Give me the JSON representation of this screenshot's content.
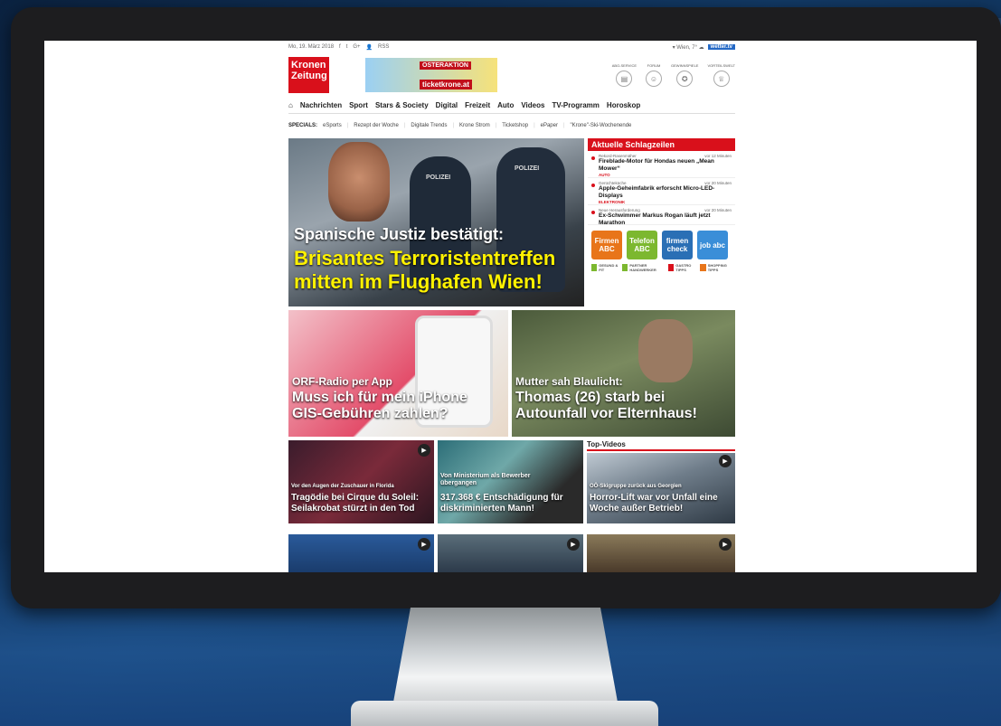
{
  "topbar": {
    "date": "Mo, 19. März 2018",
    "social": [
      "f",
      "t",
      "G+",
      "👤",
      "RSS"
    ],
    "weather": "▾ Wien, 7° ☁",
    "wetter_label": "wetter.tv"
  },
  "header": {
    "logo_line1": "Kronen",
    "logo_line2": "Zeitung",
    "banner_top": "OSTERAKTION",
    "banner_bottom": "ticketkrone.at",
    "icons": [
      {
        "label": "ABO-SERVICE",
        "icon": "newspaper-icon"
      },
      {
        "label": "FORUM",
        "icon": "forum-icon"
      },
      {
        "label": "GEWINNSPIELE",
        "icon": "prize-icon"
      },
      {
        "label": "VORTEILSWELT",
        "icon": "gift-icon"
      }
    ]
  },
  "nav": {
    "home_icon": "home-icon",
    "items": [
      "Nachrichten",
      "Sport",
      "Stars & Society",
      "Digital",
      "Freizeit",
      "Auto",
      "Videos",
      "TV-Programm",
      "Horoskop"
    ]
  },
  "specials": {
    "label": "SPECIALS:",
    "items": [
      "eSports",
      "Rezept der Woche",
      "Digitale Trends",
      "Krone Strom",
      "Ticketshop",
      "ePaper",
      "\"Krone\"-Ski-Wochenende"
    ]
  },
  "hero": {
    "kicker": "Spanische Justiz bestätigt:",
    "title_line1": "Brisantes Terroristentreffen",
    "title_line2": "mitten im Flughafen Wien!",
    "police1": "POLIZEI",
    "police2": "POLIZEI"
  },
  "headlines": {
    "title": "Aktuelle Schlagzeilen",
    "items": [
      {
        "kicker": "Rekord-Rasenmäher",
        "time": "vor 12 Minuten",
        "title": "Fireblade-Motor für Hondas neuen „Mean Mower“",
        "category": "AUTO"
      },
      {
        "kicker": "Gerüchteküche",
        "time": "vor 20 Minuten",
        "title": "Apple-Geheimfabrik erforscht Micro-LED-Displays",
        "category": "ELEKTRONIK"
      },
      {
        "kicker": "Neue Herausforderung",
        "time": "vor 20 Minuten",
        "title": "Ex-Schwimmer Markus Rogan läuft jetzt Marathon",
        "category": ""
      }
    ],
    "tiles": [
      {
        "label": "Firmen ABC",
        "color": "#e8751a"
      },
      {
        "label": "Telefon ABC",
        "color": "#7cb82f"
      },
      {
        "label": "firmen check",
        "color": "#2a6fb5"
      },
      {
        "label": "job abc",
        "color": "#3a8ed8"
      }
    ],
    "mini": [
      {
        "label": "GESUND & FIT",
        "color": "#7cb82f"
      },
      {
        "label": "PARTNER HANDWERKER",
        "color": "#7cb82f"
      },
      {
        "label": "GASTRO TIPPS",
        "color": "#d9101b"
      },
      {
        "label": "SHOPPING TIPPS",
        "color": "#e8751a"
      }
    ]
  },
  "cards": {
    "orf": {
      "kicker": "ORF-Radio per App",
      "title": "Muss ich für mein iPhone GIS-Gebühren zahlen?"
    },
    "accident": {
      "kicker": "Mutter sah Blaulicht:",
      "title": "Thomas (26) starb bei Autounfall vor Elternhaus!"
    },
    "cirque": {
      "kicker": "Vor den Augen der Zuschauer in Florida",
      "title": "Tragödie bei Cirque du Soleil: Seilakrobat stürzt in den Tod"
    },
    "ministry": {
      "kicker": "Von Ministerium als Bewerber übergangen",
      "title": "317.368 € Entschädigung für diskriminierten Mann!"
    },
    "topvideos": {
      "header": "Top-Videos",
      "kicker": "OÖ-Skigruppe zurück aus Georgien",
      "title": "Horror-Lift war vor Unfall eine Woche außer Betrieb!"
    }
  }
}
